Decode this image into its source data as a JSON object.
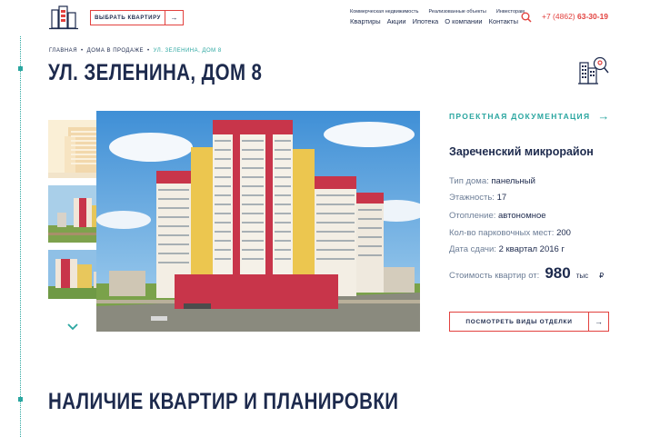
{
  "header": {
    "pick_button_label": "ВЫБРАТЬ КВАРТИРУ",
    "pick_button_arrow": "→",
    "nav_small": [
      "Коммерческая недвижимость",
      "Реализованные объекты",
      "Инвесторам"
    ],
    "nav_main": [
      "Квартиры",
      "Акции",
      "Ипотека",
      "О компании",
      "Контакты"
    ],
    "phone_prefix": "+7 (4862)",
    "phone_number": "63-30-19"
  },
  "breadcrumb": {
    "items": [
      "ГЛАВНАЯ",
      "ДОМА В ПРОДАЖЕ",
      "УЛ. ЗЕЛЕНИНА, ДОМ 8"
    ],
    "separator": "•"
  },
  "page_title": "УЛ. ЗЕЛЕНИНА, ДОМ 8",
  "info": {
    "doc_link_label": "ПРОЕКТНАЯ ДОКУМЕНТАЦИЯ",
    "doc_link_arrow": "→",
    "district": "Зареченский микрорайон",
    "properties": [
      {
        "key": "Тип дома:",
        "value": "панельный"
      },
      {
        "key": "Этажность:",
        "value": "17"
      },
      {
        "key": "Отопление:",
        "value": "автономное"
      },
      {
        "key": "Кол-во парковочных мест:",
        "value": "200"
      },
      {
        "key": "Дата сдачи:",
        "value": "2 квартал 2016 г"
      }
    ],
    "price_label": "Стоимость квартир от:",
    "price_value": "980",
    "price_unit": "тыс",
    "price_currency": "₽",
    "finish_button_label": "ПОСМОТРЕТЬ ВИДЫ ОТДЕЛКИ",
    "finish_button_arrow": "→"
  },
  "section_title": "НАЛИЧИЕ КВАРТИР И ПЛАНИРОВКИ",
  "colors": {
    "accent_red": "#e2413e",
    "accent_teal": "#2aa6a0",
    "text_navy": "#1d2a4d",
    "label_gray": "#6d7e97"
  },
  "icons": {
    "logo": "building-logo-icon",
    "search": "search-icon",
    "building": "building-key-icon",
    "gallery_down": "chevron-down-icon"
  }
}
